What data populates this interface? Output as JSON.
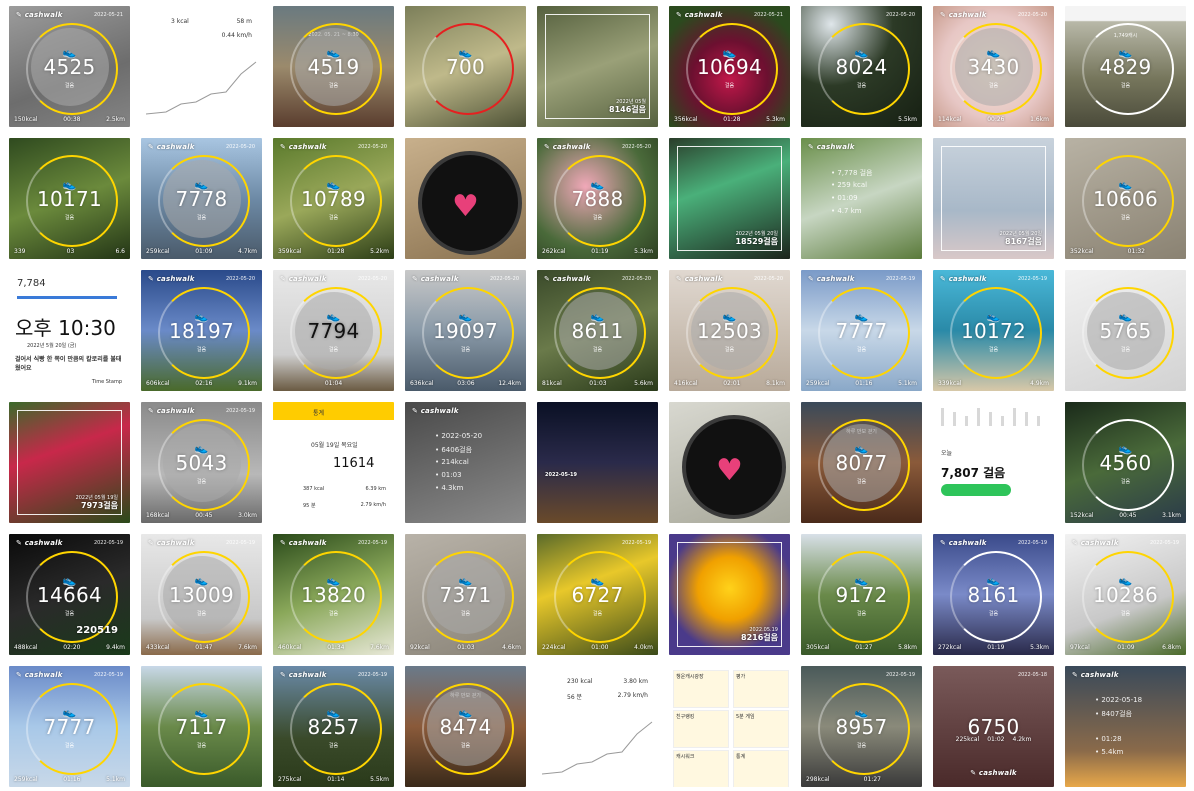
{
  "gallery": {
    "tiles": [
      {
        "kind": "ring",
        "bg": "linear-gradient(160deg,#9c9c9c,#6d6d6d 60%,#848484)",
        "brand": "cashwalk",
        "date": "2022-05-21",
        "steps": "4525",
        "unit": "걸음",
        "stats": [
          "150kcal",
          "00:38",
          "2.5km"
        ],
        "arc": "#ffd500",
        "fill": true
      },
      {
        "kind": "chart",
        "bg": "#ffffff",
        "kcal": "3 kcal",
        "km": "58 m",
        "speed": "0.44 km/h"
      },
      {
        "kind": "ring",
        "bg": "linear-gradient(180deg,#6a7a80,#9b8a6c 50%,#5a3d2e)",
        "brand": "",
        "date": "",
        "steps": "4519",
        "unit": "걸음",
        "stats": [
          "",
          "",
          ""
        ],
        "arc": "#ffd500",
        "fill": true,
        "top": "2022. 05. 21 ~ 8:30"
      },
      {
        "kind": "ring",
        "bg": "linear-gradient(160deg,#7c7f5a,#bfb98a 50%,#4e5236)",
        "brand": "",
        "date": "",
        "steps": "700",
        "unit": "",
        "stats": [
          "",
          "",
          ""
        ],
        "arc": "#e52020",
        "fill": false
      },
      {
        "kind": "frame",
        "bg": "linear-gradient(160deg,#55603e,#9aa078 50%,#56613f)",
        "caption": "8146걸음",
        "sub": "2022년 05월"
      },
      {
        "kind": "ring",
        "bg": "radial-gradient(circle at 50% 60%,#c2184a,#6c1030 40%,#2b4a1e 80%)",
        "brand": "cashwalk",
        "date": "2022-05-21",
        "steps": "10694",
        "unit": "걸음",
        "stats": [
          "356kcal",
          "01:28",
          "5.3km"
        ],
        "arc": "#ffd500",
        "fill": false
      },
      {
        "kind": "ring",
        "bg": "radial-gradient(circle at 25% 15%,#dfe6ea,#2c3a26 45%,#1a2416 90%)",
        "brand": "",
        "date": "2022-05-20",
        "steps": "8024",
        "unit": "걸음",
        "stats": [
          "",
          "",
          "5.5km"
        ],
        "arc": "#ffd500",
        "fill": false
      },
      {
        "kind": "ring",
        "bg": "radial-gradient(circle at 50% 50%,#f4e4cf,#e7c7c5 60%,#c79a8a)",
        "brand": "cashwalk",
        "date": "2022-05-20",
        "steps": "3430",
        "unit": "걸음",
        "stats": [
          "114kcal",
          "00:26",
          "1.6km"
        ],
        "arc": "#ffd500",
        "fill": true
      },
      {
        "kind": "ring",
        "bg": "linear-gradient(180deg,#f4f4f4 0%,#f4f4f4 12%,#b8b8a8 13%,#76765c 60%,#4a4a3a)",
        "brand": "",
        "date": "",
        "steps": "4829",
        "unit": "걸음",
        "stats": [
          "",
          "",
          ""
        ],
        "arc": "#ffffff",
        "fill": false,
        "top": "1,749캐시"
      },
      {
        "kind": "ring",
        "bg": "linear-gradient(160deg,#2f4a1f,#6b8a3c 50%,#233516)",
        "brand": "",
        "date": "",
        "steps": "10171",
        "unit": "걸음",
        "stats": [
          "339",
          "03",
          "6.6"
        ],
        "arc": "#ffd500",
        "fill": false
      },
      {
        "kind": "ring",
        "bg": "linear-gradient(180deg,#a9c6e2,#6d8aa6 50%,#4a5a6a)",
        "brand": "cashwalk",
        "date": "2022-05-20",
        "steps": "7778",
        "unit": "걸음",
        "stats": [
          "259kcal",
          "01:09",
          "4.7km"
        ],
        "arc": "#ffd500",
        "fill": true
      },
      {
        "kind": "ring",
        "bg": "linear-gradient(160deg,#5a7a2c,#9aa85a 50%,#2c3d16)",
        "brand": "cashwalk",
        "date": "2022-05-20",
        "steps": "10789",
        "unit": "걸음",
        "stats": [
          "359kcal",
          "01:28",
          "5.2km"
        ],
        "arc": "#ffd500",
        "fill": false
      },
      {
        "kind": "watch",
        "bg": "linear-gradient(160deg,#c8b08c,#8a7250)",
        "steps": "",
        "unit": "",
        "stats": [
          "",
          "",
          ""
        ]
      },
      {
        "kind": "ring",
        "bg": "radial-gradient(circle at 40% 40%,#f0a8b8,#4a6a3a 60%,#2d3f22)",
        "brand": "cashwalk",
        "date": "2022-05-20",
        "steps": "7888",
        "unit": "걸음",
        "stats": [
          "262kcal",
          "01:19",
          "5.3km"
        ],
        "arc": "#ffd500",
        "fill": false
      },
      {
        "kind": "frame",
        "bg": "linear-gradient(160deg,#2a3d2a,#4ab07a 40%,#1c241c)",
        "caption": "18529걸음",
        "sub": "2022년 05월 20일"
      },
      {
        "kind": "list",
        "bg": "linear-gradient(160deg,#6a8f4a,#c7d6c2 50%,#5a7a3a)",
        "brand": "cashwalk",
        "lines": [
          "7,778 걸음",
          "259 kcal",
          "01:09",
          "4.7 km"
        ]
      },
      {
        "kind": "frame",
        "bg": "linear-gradient(180deg,#c8d2dc,#a8b8c8 60%,#d8c8c8)",
        "caption": "8167걸음",
        "sub": "2022년 05월 20일"
      },
      {
        "kind": "ring",
        "bg": "linear-gradient(160deg,#b8b2a4,#8a8272)",
        "brand": "",
        "date": "",
        "steps": "10606",
        "unit": "걸음",
        "stats": [
          "352kcal",
          "01:32",
          ""
        ],
        "arc": "#ffd500",
        "fill": false
      },
      {
        "kind": "clock",
        "bg": "#ffffff",
        "steps": "7,784",
        "time": "오후 10:30",
        "date": "2022년 5월 20일 (금)",
        "msg": "걸어서 식빵 한 쪽이 만큼의 칼로리를 불태웠어요",
        "stamp": "Time Stamp"
      },
      {
        "kind": "ring",
        "bg": "linear-gradient(180deg,#2a4a8a,#6a8ac8 50%,#4a6a2a)",
        "brand": "cashwalk",
        "date": "2022-05-20",
        "steps": "18197",
        "unit": "걸음",
        "stats": [
          "606kcal",
          "02:16",
          "9.1km"
        ],
        "arc": "#ffd500",
        "fill": false
      },
      {
        "kind": "ring",
        "bg": "linear-gradient(180deg,#e8e8e8,#cfcfcf 70%,#6a5a42)",
        "brand": "cashwalk",
        "date": "2022-05-20",
        "steps": "7794",
        "unit": "걸음",
        "stats": [
          "",
          "01:04",
          ""
        ],
        "arc": "#ffd500",
        "fill": true,
        "dark": true
      },
      {
        "kind": "ring",
        "bg": "linear-gradient(180deg,#c8c8c8,#8a9aa8 50%,#4a5a6a)",
        "brand": "cashwalk",
        "date": "2022-05-20",
        "steps": "19097",
        "unit": "걸음",
        "stats": [
          "636kcal",
          "03:06",
          "12.4km"
        ],
        "arc": "#ffd500",
        "fill": false
      },
      {
        "kind": "ring",
        "bg": "linear-gradient(160deg,#3a4a2a,#6a7a4a 50%,#2a3a1a)",
        "brand": "cashwalk",
        "date": "2022-05-20",
        "steps": "8611",
        "unit": "걸음",
        "stats": [
          "81kcal",
          "01:03",
          "5.6km"
        ],
        "arc": "#ffd500",
        "fill": true
      },
      {
        "kind": "ring",
        "bg": "linear-gradient(180deg,#e0d8d0,#b8aa9a)",
        "brand": "cashwalk",
        "date": "2022-05-20",
        "steps": "12503",
        "unit": "걸음",
        "stats": [
          "416kcal",
          "02:01",
          "8.1km"
        ],
        "arc": "#ffd500",
        "fill": true
      },
      {
        "kind": "ring",
        "bg": "linear-gradient(180deg,#7a9ac8,#c8d8e8 50%,#8aa8c8)",
        "brand": "cashwalk",
        "date": "2022-05-19",
        "steps": "7777",
        "unit": "걸음",
        "stats": [
          "259kcal",
          "01:16",
          "5.1km"
        ],
        "arc": "#ffd500",
        "fill": false
      },
      {
        "kind": "ring",
        "bg": "linear-gradient(180deg,#4ab8d8,#2a8aa8 50%,#d8c8a8)",
        "brand": "cashwalk",
        "date": "2022-05-19",
        "steps": "10172",
        "unit": "걸음",
        "stats": [
          "339kcal",
          "",
          "4.9km"
        ],
        "arc": "#ffd500",
        "fill": false
      },
      {
        "kind": "ring",
        "bg": "linear-gradient(160deg,#f2f2f2,#d2d2d2)",
        "brand": "",
        "date": "",
        "steps": "5765",
        "unit": "걸음",
        "stats": [
          "",
          "",
          ""
        ],
        "arc": "#ffd500",
        "fill": true
      },
      {
        "kind": "frame",
        "bg": "linear-gradient(160deg,#3a6a2a,#c8284a 40%,#2a4a1a)",
        "caption": "7973걸음",
        "sub": "2022년 05월 19일"
      },
      {
        "kind": "ring",
        "bg": "linear-gradient(180deg,#8a8a8a,#b8b8b8 60%,#6a6a6a)",
        "brand": "cashwalk",
        "date": "2022-05-19",
        "steps": "5043",
        "unit": "걸음",
        "stats": [
          "168kcal",
          "00:45",
          "3.0km"
        ],
        "arc": "#ffd500",
        "fill": true
      },
      {
        "kind": "walkapp",
        "bg": "#ffffff",
        "title": "통계",
        "date": "05월 19일 목요일",
        "steps": "11614",
        "unit": "걸음",
        "kcal": "387 kcal",
        "km": "6.39 km",
        "time": "95 분",
        "speed": "2.79 km/h"
      },
      {
        "kind": "list",
        "bg": "linear-gradient(160deg,#4a4a4a,#8a8a8a)",
        "brand": "cashwalk",
        "lines": [
          "2022-05-20",
          "6406걸음",
          "214kcal",
          "01:03",
          "4.3km"
        ]
      },
      {
        "kind": "night",
        "bg": "linear-gradient(180deg,#0a1024,#2a2a4a 50%,#6a4a2a)",
        "caption": "2022-05-19"
      },
      {
        "kind": "watch",
        "bg": "linear-gradient(160deg,#d8d8d0,#a8a89a)",
        "steps": "",
        "unit": "",
        "stats": [
          "",
          "",
          ""
        ]
      },
      {
        "kind": "ring",
        "bg": "linear-gradient(180deg,#3a4a5a,#8a5a3a 50%,#4a2a1a)",
        "brand": "",
        "date": "",
        "steps": "8077",
        "unit": "걸음",
        "stats": [
          "",
          "",
          ""
        ],
        "arc": "#ffd500",
        "fill": true,
        "top": "하루 만보 걷기"
      },
      {
        "kind": "bars",
        "bg": "#ffffff",
        "today": "오늘",
        "steps": "7,807 걸음",
        "dates": [
          "11",
          "12",
          "13",
          "14",
          "15",
          "16",
          "17",
          "18",
          "19"
        ]
      },
      {
        "kind": "ring",
        "bg": "linear-gradient(160deg,#1a2a1a,#4a6a3a 50%,#2a3a4a)",
        "brand": "",
        "date": "",
        "steps": "4560",
        "unit": "걸음",
        "stats": [
          "152kcal",
          "00:45",
          "3.1km"
        ],
        "arc": "#ffffff",
        "fill": false
      },
      {
        "kind": "ring",
        "bg": "linear-gradient(160deg,#0a0a0a,#2a2a2a 50%,#1a3a1a)",
        "brand": "cashwalk",
        "date": "2022-05-19",
        "steps": "14664",
        "unit": "걸음",
        "stats": [
          "488kcal",
          "02:20",
          "9.4km"
        ],
        "arc": "#ffd500",
        "fill": false,
        "extra": "220519"
      },
      {
        "kind": "ring",
        "bg": "linear-gradient(180deg,#e8e8e8,#c8c8c8 70%,#8a6a4a)",
        "brand": "cashwalk",
        "date": "2022-05-19",
        "steps": "13009",
        "unit": "걸음",
        "stats": [
          "433kcal",
          "01:47",
          "7.6km"
        ],
        "arc": "#ffd500",
        "fill": true
      },
      {
        "kind": "ring",
        "bg": "linear-gradient(160deg,#2a4a1a,#8aa85a 50%,#e8e8d8)",
        "brand": "cashwalk",
        "date": "2022-05-19",
        "steps": "13820",
        "unit": "걸음",
        "stats": [
          "460kcal",
          "01:34",
          "7.6km"
        ],
        "arc": "#ffd500",
        "fill": false
      },
      {
        "kind": "ring",
        "bg": "linear-gradient(160deg,#b8b2a8,#8a8478)",
        "brand": "",
        "date": "",
        "steps": "7371",
        "unit": "걸음",
        "stats": [
          "92kcal",
          "01:03",
          "4.6km"
        ],
        "arc": "#ffd500",
        "fill": true
      },
      {
        "kind": "ring",
        "bg": "linear-gradient(160deg,#5a6a2a,#e8c82a 40%,#3a4a1a)",
        "brand": "",
        "date": "2022-05-19",
        "steps": "6727",
        "unit": "걸음",
        "stats": [
          "224kcal",
          "01:00",
          "4.0km"
        ],
        "arc": "#ffd500",
        "fill": false
      },
      {
        "kind": "frame",
        "bg": "radial-gradient(circle at 50% 45%,#ffd21a,#f0a000 35%,#4a3a8a 70%)",
        "caption": "8216걸음",
        "sub": "2022.05.19"
      },
      {
        "kind": "ring",
        "bg": "linear-gradient(180deg,#d8e0e8,#6a8a4a 50%,#3a5a2a)",
        "brand": "",
        "date": "",
        "steps": "9172",
        "unit": "걸음",
        "stats": [
          "305kcal",
          "01:27",
          "5.8km"
        ],
        "arc": "#ffd500",
        "fill": false
      },
      {
        "kind": "ring",
        "bg": "linear-gradient(180deg,#3a4a8a,#7a8ac8 50%,#2a2a4a)",
        "brand": "cashwalk",
        "date": "2022-05-19",
        "steps": "8161",
        "unit": "걸음",
        "stats": [
          "272kcal",
          "01:19",
          "5.3km"
        ],
        "arc": "#ffffff",
        "fill": false
      },
      {
        "kind": "ring",
        "bg": "linear-gradient(160deg,#f2f2f2,#c8c8c8 60%,#4a6a2a)",
        "brand": "cashwalk",
        "date": "2022-05-19",
        "steps": "10286",
        "unit": "걸음",
        "stats": [
          "97kcal",
          "01:09",
          "6.8km"
        ],
        "arc": "#ffd500",
        "fill": false
      },
      {
        "kind": "ring",
        "bg": "linear-gradient(180deg,#6a8ac8,#a8c8e8 50%,#c8d8e8)",
        "brand": "cashwalk",
        "date": "2022-05-19",
        "steps": "7777",
        "unit": "걸음",
        "stats": [
          "259kcal",
          "01:16",
          "5.1km"
        ],
        "arc": "#ffd500",
        "fill": false
      },
      {
        "kind": "ring",
        "bg": "linear-gradient(180deg,#c8d8e8,#6a8a4a 50%,#3a5a2a)",
        "brand": "",
        "date": "",
        "steps": "7117",
        "unit": "걸음",
        "stats": [
          "",
          "",
          ""
        ],
        "arc": "#ffd500",
        "fill": false
      },
      {
        "kind": "ring",
        "bg": "linear-gradient(180deg,#6a8aa8,#3a4a2a 60%,#2a3a1a)",
        "brand": "cashwalk",
        "date": "2022-05-19",
        "steps": "8257",
        "unit": "걸음",
        "stats": [
          "275kcal",
          "01:14",
          "5.5km"
        ],
        "arc": "#ffd500",
        "fill": false
      },
      {
        "kind": "ring",
        "bg": "linear-gradient(180deg,#6a7a8a,#8a5a3a 50%,#3a2a1a)",
        "brand": "",
        "date": "",
        "steps": "8474",
        "unit": "걸음",
        "stats": [
          "",
          "",
          ""
        ],
        "arc": "#ffd500",
        "fill": true,
        "top": "하루 만보 걷기"
      },
      {
        "kind": "chart",
        "bg": "#ffffff",
        "kcal": "230 kcal",
        "km": "3.80 km",
        "speed": "2.79 km/h",
        "time": "56 분"
      },
      {
        "kind": "menu",
        "bg": "#ffffff",
        "items": [
          "챙운캐시광장",
          "평가",
          "친구랭킹",
          "5분 게임",
          "캐시워크",
          "통계"
        ]
      },
      {
        "kind": "ring",
        "bg": "linear-gradient(180deg,#4a5a5a,#8a8a7a 50%,#3a3a3a)",
        "brand": "",
        "date": "2022-05-19",
        "steps": "8957",
        "unit": "걸음",
        "stats": [
          "298kcal",
          "01:27",
          ""
        ],
        "arc": "#ffd500",
        "fill": false
      },
      {
        "kind": "plain",
        "bg": "linear-gradient(180deg,#7a5a5a,#4a2a2a)",
        "date": "2022-05-18",
        "steps": "6750",
        "stats": [
          "225kcal",
          "01:02",
          "4.2km"
        ],
        "brand": "cashwalk"
      },
      {
        "kind": "list",
        "bg": "linear-gradient(180deg,#3a4a5a,#8a6a4a 70%,#e8a84a)",
        "brand": "cashwalk",
        "lines": [
          "2022-05-18",
          "8407걸음",
          "",
          "01:28",
          "5.4km"
        ]
      }
    ]
  }
}
